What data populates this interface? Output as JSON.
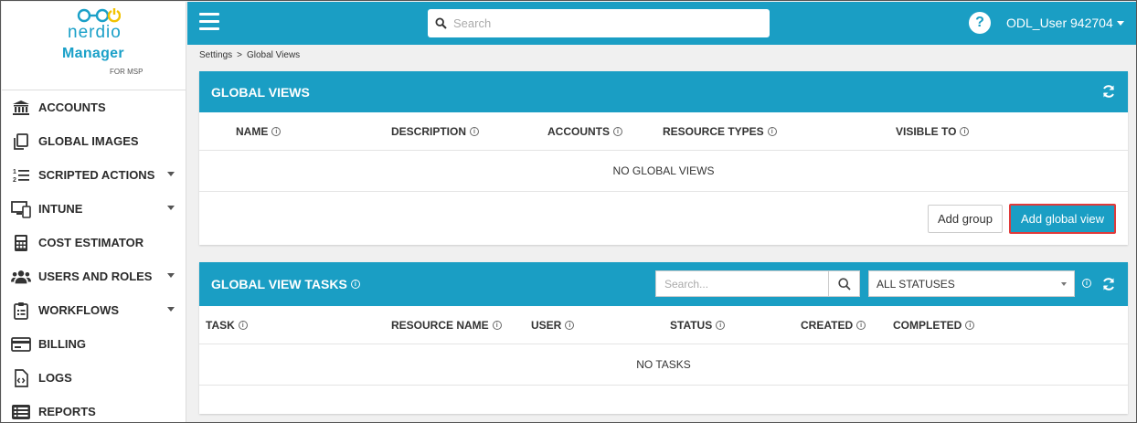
{
  "brand": {
    "nerdio": "nerdio",
    "manager": "Manager",
    "for_msp": "FOR MSP"
  },
  "sidebar": {
    "items": [
      {
        "label": "ACCOUNTS",
        "icon": "bank-icon",
        "has_caret": false
      },
      {
        "label": "GLOBAL IMAGES",
        "icon": "copy-icon",
        "has_caret": false
      },
      {
        "label": "SCRIPTED ACTIONS",
        "icon": "ordered-list-icon",
        "has_caret": true
      },
      {
        "label": "INTUNE",
        "icon": "devices-icon",
        "has_caret": true
      },
      {
        "label": "COST ESTIMATOR",
        "icon": "calculator-icon",
        "has_caret": false
      },
      {
        "label": "USERS AND ROLES",
        "icon": "users-icon",
        "has_caret": true
      },
      {
        "label": "WORKFLOWS",
        "icon": "clipboard-icon",
        "has_caret": true
      },
      {
        "label": "BILLING",
        "icon": "credit-card-icon",
        "has_caret": false
      },
      {
        "label": "LOGS",
        "icon": "code-file-icon",
        "has_caret": false
      },
      {
        "label": "REPORTS",
        "icon": "list-icon",
        "has_caret": false
      }
    ]
  },
  "topbar": {
    "search_placeholder": "Search",
    "help": "?",
    "user": "ODL_User 942704"
  },
  "breadcrumb": {
    "parent": "Settings",
    "separator": ">",
    "current": "Global Views"
  },
  "global_views": {
    "title": "GLOBAL VIEWS",
    "columns": [
      "NAME",
      "DESCRIPTION",
      "ACCOUNTS",
      "RESOURCE TYPES",
      "VISIBLE TO"
    ],
    "empty": "NO GLOBAL VIEWS",
    "add_group": "Add group",
    "add_global_view": "Add global view"
  },
  "tasks": {
    "title": "GLOBAL VIEW TASKS",
    "search_placeholder": "Search...",
    "status_value": "ALL STATUSES",
    "columns": [
      "TASK",
      "RESOURCE NAME",
      "USER",
      "STATUS",
      "CREATED",
      "COMPLETED"
    ],
    "empty": "NO TASKS"
  },
  "colors": {
    "accent": "#1a9ec4",
    "highlight": "#e03a3a"
  }
}
